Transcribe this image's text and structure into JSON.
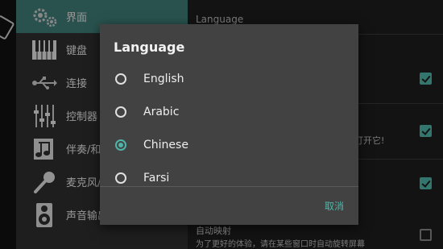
{
  "colors": {
    "accent": "#4eb5a8",
    "sidebar_active": "#3f7e78",
    "dialog_bg": "#424242"
  },
  "sidebar": {
    "items": [
      {
        "label": "界面",
        "icon": "gears-icon"
      },
      {
        "label": "键盘",
        "icon": "piano-keys-icon"
      },
      {
        "label": "连接",
        "icon": "usb-icon"
      },
      {
        "label": "控制器",
        "icon": "sliders-icon"
      },
      {
        "label": "伴奏/和弦",
        "icon": "music-note-icon"
      },
      {
        "label": "麦克风/录",
        "icon": "microphone-icon"
      },
      {
        "label": "声音输出",
        "icon": "speaker-icon"
      }
    ]
  },
  "main": {
    "header": "Language",
    "behind_text": "打开它!",
    "auto_rotate_title": "自动映射",
    "auto_rotate_desc": "为了更好的体验，请在某些窗口时自动旋转屏幕"
  },
  "dialog": {
    "title": "Language",
    "options": [
      {
        "label": "English",
        "selected": false
      },
      {
        "label": "Arabic",
        "selected": false
      },
      {
        "label": "Chinese",
        "selected": true
      },
      {
        "label": "Farsi",
        "selected": false
      }
    ],
    "cancel_label": "取消"
  }
}
